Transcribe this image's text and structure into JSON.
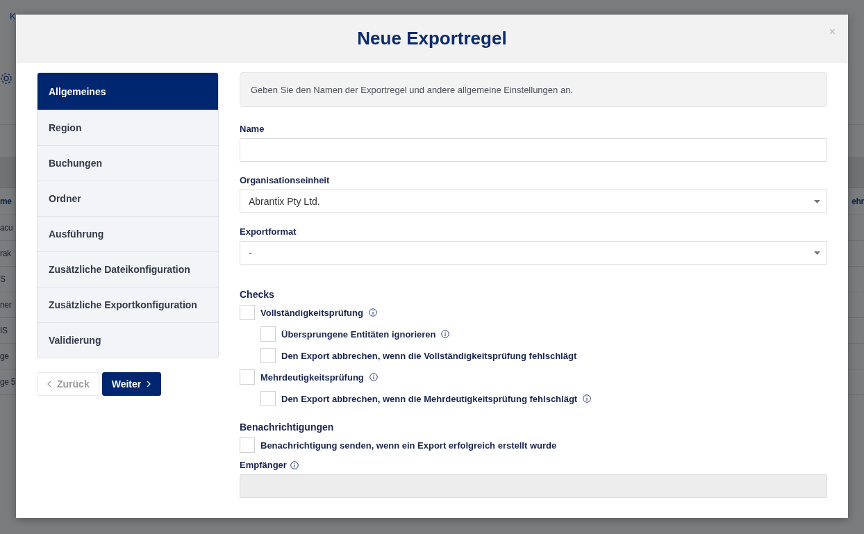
{
  "background": {
    "breadcrumb": "K",
    "table_header": "me",
    "rows": [
      "acu",
      "rak",
      "S",
      "ner",
      "IS",
      "ge",
      "ge 5"
    ],
    "right_header": "ehr"
  },
  "dialog": {
    "title": "Neue Exportregel",
    "close": "×",
    "steps": [
      {
        "label": "Allgemeines",
        "selected": true
      },
      {
        "label": "Region",
        "selected": false
      },
      {
        "label": "Buchungen",
        "selected": false
      },
      {
        "label": "Ordner",
        "selected": false
      },
      {
        "label": "Ausführung",
        "selected": false
      },
      {
        "label": "Zusätzliche Dateikonfiguration",
        "selected": false
      },
      {
        "label": "Zusätzliche Exportkonfiguration",
        "selected": false
      },
      {
        "label": "Validierung",
        "selected": false
      }
    ],
    "back_button": {
      "label": "Zurück",
      "disabled": true
    },
    "next_button": {
      "label": "Weiter",
      "disabled": false
    },
    "intro": "Geben Sie den Namen der Exportregel und andere allgemeine Einstellungen an.",
    "fields": [
      {
        "kind": "text",
        "label": "Name"
      },
      {
        "kind": "select",
        "label": "Organisationseinheit",
        "value": "Abrantix Pty Ltd."
      },
      {
        "kind": "select",
        "label": "Exportformat",
        "value": "-"
      }
    ],
    "checks": {
      "title": "Checks",
      "items": [
        {
          "label": "Vollständigkeitsprüfung",
          "checked": false,
          "info": true,
          "children": [
            {
              "label": "Übersprungene Entitäten ignorieren",
              "checked": false,
              "info": true
            },
            {
              "label": "Den Export abbrechen, wenn die Vollständigkeitsprüfung fehlschlägt",
              "checked": false,
              "info": false
            }
          ]
        },
        {
          "label": "Mehrdeutigkeitsprüfung",
          "checked": false,
          "info": true,
          "children": [
            {
              "label": "Den Export abbrechen, wenn die Mehrdeutigkeitsprüfung fehlschlägt",
              "checked": false,
              "info": true
            }
          ]
        }
      ]
    },
    "notifications": {
      "title": "Benachrichtigungen",
      "items": [
        {
          "label": "Benachrichtigung senden, wenn ein Export erfolgreich erstellt wurde",
          "checked": false,
          "info": false
        }
      ]
    },
    "recipient": {
      "label": "Empfänger",
      "info": true,
      "disabled": true
    }
  }
}
